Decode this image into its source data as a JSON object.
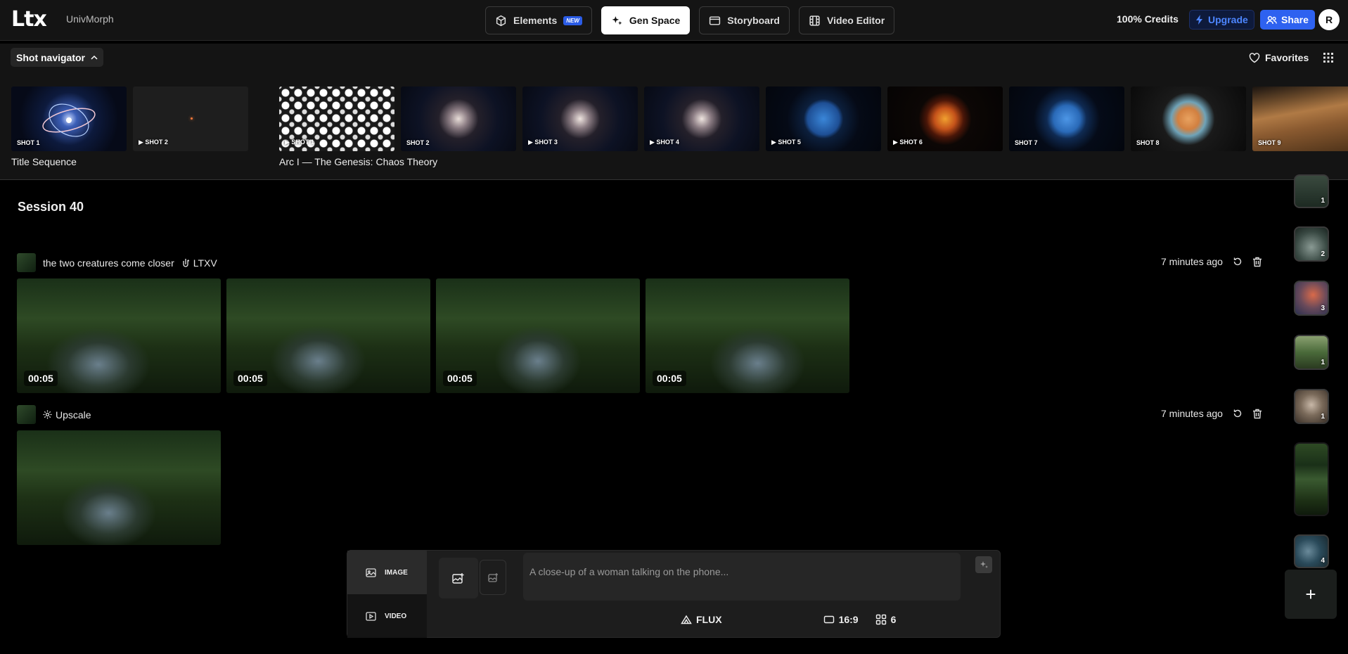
{
  "header": {
    "logo": "Ltx",
    "project_name": "UnivMorph",
    "tabs": [
      {
        "label": "Elements",
        "badge": "NEW"
      },
      {
        "label": "Gen Space"
      },
      {
        "label": "Storyboard"
      },
      {
        "label": "Video Editor"
      }
    ],
    "credits": "100% Credits",
    "upgrade_label": "Upgrade",
    "share_label": "Share",
    "avatar_initials": "R"
  },
  "shot_bar": {
    "navigator_label": "Shot navigator",
    "favorites_label": "Favorites"
  },
  "shot_groups": [
    {
      "title": "Title Sequence",
      "shots": [
        {
          "label": "SHOT 1",
          "play": false
        },
        {
          "label": "SHOT 2",
          "play": true
        }
      ]
    },
    {
      "title": "Arc I — The Genesis: Chaos Theory",
      "shots": [
        {
          "label": "SHOT 1",
          "play": true
        },
        {
          "label": "SHOT 2",
          "play": false
        },
        {
          "label": "SHOT 3",
          "play": true
        },
        {
          "label": "SHOT 4",
          "play": true
        },
        {
          "label": "SHOT 5",
          "play": true
        },
        {
          "label": "SHOT 6",
          "play": true
        },
        {
          "label": "SHOT 7",
          "play": false
        },
        {
          "label": "SHOT 8",
          "play": false
        },
        {
          "label": "SHOT 9",
          "play": false
        }
      ]
    }
  ],
  "session": {
    "title": "Session 40",
    "generations": [
      {
        "prompt": "the two creatures come closer",
        "model": "LTXV",
        "time": "7 minutes ago",
        "durations": [
          "00:05",
          "00:05",
          "00:05",
          "00:05"
        ]
      },
      {
        "prompt": "Upscale",
        "time": "7 minutes ago"
      }
    ]
  },
  "rail": {
    "counts": [
      "1",
      "2",
      "3",
      "1",
      "1",
      "4"
    ]
  },
  "prompt_panel": {
    "modes": [
      "IMAGE",
      "VIDEO"
    ],
    "placeholder": "A close-up of a woman talking on the phone...",
    "model": "FLUX",
    "aspect": "16:9",
    "count": "6"
  }
}
